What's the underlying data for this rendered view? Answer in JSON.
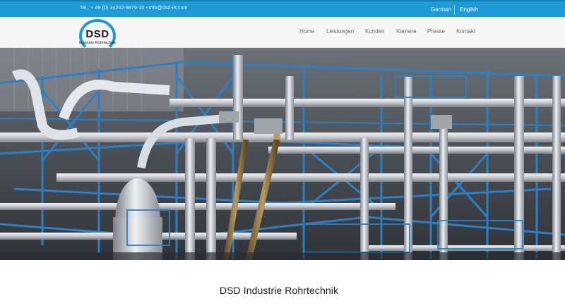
{
  "topbar": {
    "contact": "Tel.: + 49 (0) 34202-9879-10 • info@dsd-irt.com",
    "languages": [
      "German",
      "English"
    ]
  },
  "logo": {
    "mark": "DSD",
    "subtitle": "Industrie Rohrtechnik"
  },
  "nav": {
    "items": [
      "Home",
      "Leistungen",
      "Kunden",
      "Karriere",
      "Presse",
      "Kontakt"
    ]
  },
  "hero": {
    "image": "industrial-pipeline-photo"
  },
  "main": {
    "title": "DSD Industrie Rohrtechnik"
  },
  "colors": {
    "topbar": "#1e9ad6",
    "logo_accent": "#1a9ad8",
    "steel_blue": "#2c7fc4"
  }
}
